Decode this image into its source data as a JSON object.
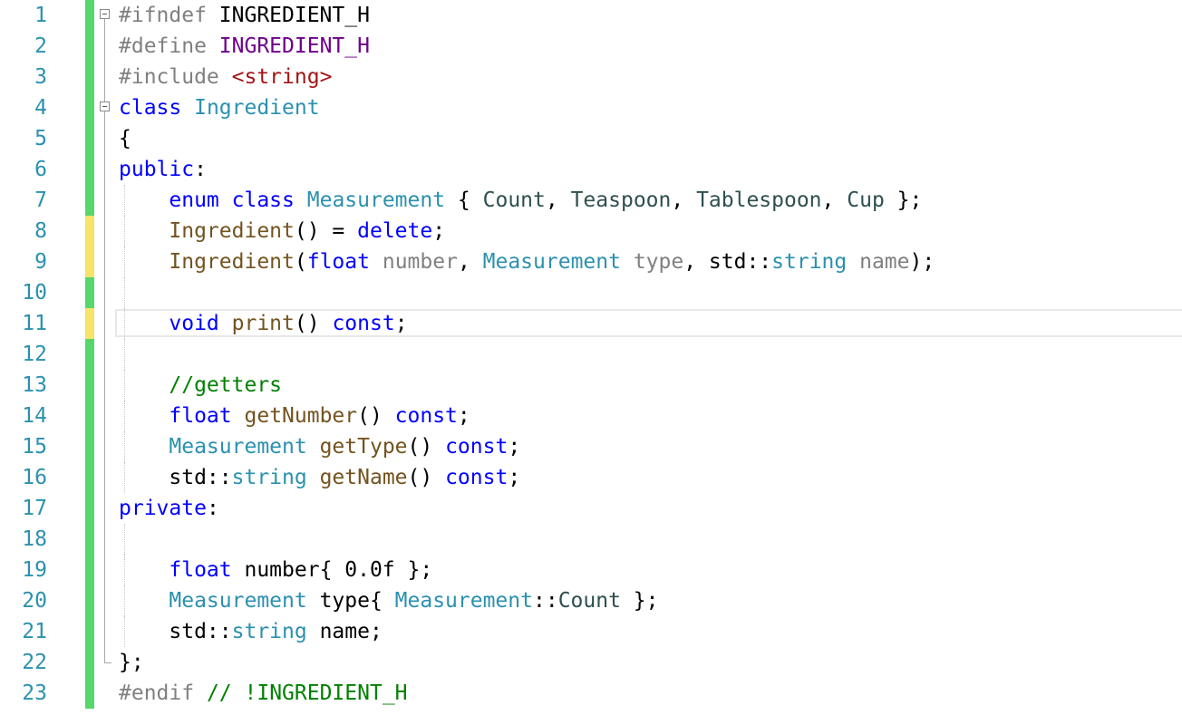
{
  "editor": {
    "lines": [
      {
        "number": "1",
        "change": "saved",
        "fold": "open",
        "segments": [
          {
            "cls": "pp",
            "text": "#ifndef"
          },
          {
            "cls": "plain",
            "text": " INGREDIENT_H"
          }
        ]
      },
      {
        "number": "2",
        "change": "saved",
        "fold": "",
        "segments": [
          {
            "cls": "pp",
            "text": "#define"
          },
          {
            "cls": "plain",
            "text": " "
          },
          {
            "cls": "mac",
            "text": "INGREDIENT_H"
          }
        ]
      },
      {
        "number": "3",
        "change": "saved",
        "fold": "",
        "segments": [
          {
            "cls": "pp",
            "text": "#include"
          },
          {
            "cls": "plain",
            "text": " "
          },
          {
            "cls": "str",
            "text": "<string>"
          }
        ]
      },
      {
        "number": "4",
        "change": "saved",
        "fold": "open",
        "segments": [
          {
            "cls": "kw",
            "text": "class"
          },
          {
            "cls": "plain",
            "text": " "
          },
          {
            "cls": "ty",
            "text": "Ingredient"
          }
        ]
      },
      {
        "number": "5",
        "change": "saved",
        "fold": "",
        "segments": [
          {
            "cls": "plain",
            "text": "{"
          }
        ]
      },
      {
        "number": "6",
        "change": "saved",
        "fold": "",
        "segments": [
          {
            "cls": "kw",
            "text": "public"
          },
          {
            "cls": "plain",
            "text": ":"
          }
        ]
      },
      {
        "number": "7",
        "change": "saved",
        "fold": "",
        "segments": [
          {
            "cls": "plain",
            "text": "    "
          },
          {
            "cls": "kw",
            "text": "enum"
          },
          {
            "cls": "plain",
            "text": " "
          },
          {
            "cls": "kw",
            "text": "class"
          },
          {
            "cls": "plain",
            "text": " "
          },
          {
            "cls": "ty",
            "text": "Measurement"
          },
          {
            "cls": "plain",
            "text": " { "
          },
          {
            "cls": "enumv",
            "text": "Count"
          },
          {
            "cls": "plain",
            "text": ", "
          },
          {
            "cls": "enumv",
            "text": "Teaspoon"
          },
          {
            "cls": "plain",
            "text": ", "
          },
          {
            "cls": "enumv",
            "text": "Tablespoon"
          },
          {
            "cls": "plain",
            "text": ", "
          },
          {
            "cls": "enumv",
            "text": "Cup"
          },
          {
            "cls": "plain",
            "text": " };"
          }
        ]
      },
      {
        "number": "8",
        "change": "modified",
        "fold": "",
        "segments": [
          {
            "cls": "plain",
            "text": "    "
          },
          {
            "cls": "fn",
            "text": "Ingredient"
          },
          {
            "cls": "plain",
            "text": "() = "
          },
          {
            "cls": "kw",
            "text": "delete"
          },
          {
            "cls": "plain",
            "text": ";"
          }
        ]
      },
      {
        "number": "9",
        "change": "modified",
        "fold": "",
        "segments": [
          {
            "cls": "plain",
            "text": "    "
          },
          {
            "cls": "fn",
            "text": "Ingredient"
          },
          {
            "cls": "plain",
            "text": "("
          },
          {
            "cls": "kw",
            "text": "float"
          },
          {
            "cls": "plain",
            "text": " "
          },
          {
            "cls": "param",
            "text": "number"
          },
          {
            "cls": "plain",
            "text": ", "
          },
          {
            "cls": "ty",
            "text": "Measurement"
          },
          {
            "cls": "plain",
            "text": " "
          },
          {
            "cls": "param",
            "text": "type"
          },
          {
            "cls": "plain",
            "text": ", std::"
          },
          {
            "cls": "ty",
            "text": "string"
          },
          {
            "cls": "plain",
            "text": " "
          },
          {
            "cls": "param",
            "text": "name"
          },
          {
            "cls": "plain",
            "text": ");"
          }
        ]
      },
      {
        "number": "10",
        "change": "saved",
        "fold": "",
        "segments": []
      },
      {
        "number": "11",
        "change": "modified",
        "fold": "",
        "current": true,
        "segments": [
          {
            "cls": "plain",
            "text": "    "
          },
          {
            "cls": "kw",
            "text": "void"
          },
          {
            "cls": "plain",
            "text": " "
          },
          {
            "cls": "fn",
            "text": "print"
          },
          {
            "cls": "plain",
            "text": "() "
          },
          {
            "cls": "kw",
            "text": "const"
          },
          {
            "cls": "plain",
            "text": ";"
          }
        ]
      },
      {
        "number": "12",
        "change": "saved",
        "fold": "",
        "segments": []
      },
      {
        "number": "13",
        "change": "saved",
        "fold": "",
        "segments": [
          {
            "cls": "plain",
            "text": "    "
          },
          {
            "cls": "cmt",
            "text": "//getters"
          }
        ]
      },
      {
        "number": "14",
        "change": "saved",
        "fold": "",
        "segments": [
          {
            "cls": "plain",
            "text": "    "
          },
          {
            "cls": "kw",
            "text": "float"
          },
          {
            "cls": "plain",
            "text": " "
          },
          {
            "cls": "fn",
            "text": "getNumber"
          },
          {
            "cls": "plain",
            "text": "() "
          },
          {
            "cls": "kw",
            "text": "const"
          },
          {
            "cls": "plain",
            "text": ";"
          }
        ]
      },
      {
        "number": "15",
        "change": "saved",
        "fold": "",
        "segments": [
          {
            "cls": "plain",
            "text": "    "
          },
          {
            "cls": "ty",
            "text": "Measurement"
          },
          {
            "cls": "plain",
            "text": " "
          },
          {
            "cls": "fn",
            "text": "getType"
          },
          {
            "cls": "plain",
            "text": "() "
          },
          {
            "cls": "kw",
            "text": "const"
          },
          {
            "cls": "plain",
            "text": ";"
          }
        ]
      },
      {
        "number": "16",
        "change": "saved",
        "fold": "",
        "segments": [
          {
            "cls": "plain",
            "text": "    std::"
          },
          {
            "cls": "ty",
            "text": "string"
          },
          {
            "cls": "plain",
            "text": " "
          },
          {
            "cls": "fn",
            "text": "getName"
          },
          {
            "cls": "plain",
            "text": "() "
          },
          {
            "cls": "kw",
            "text": "const"
          },
          {
            "cls": "plain",
            "text": ";"
          }
        ]
      },
      {
        "number": "17",
        "change": "saved",
        "fold": "",
        "segments": [
          {
            "cls": "kw",
            "text": "private"
          },
          {
            "cls": "plain",
            "text": ":"
          }
        ]
      },
      {
        "number": "18",
        "change": "saved",
        "fold": "",
        "segments": []
      },
      {
        "number": "19",
        "change": "saved",
        "fold": "",
        "segments": [
          {
            "cls": "plain",
            "text": "    "
          },
          {
            "cls": "kw",
            "text": "float"
          },
          {
            "cls": "plain",
            "text": " number{ 0.0f };"
          }
        ]
      },
      {
        "number": "20",
        "change": "saved",
        "fold": "",
        "segments": [
          {
            "cls": "plain",
            "text": "    "
          },
          {
            "cls": "ty",
            "text": "Measurement"
          },
          {
            "cls": "plain",
            "text": " type{ "
          },
          {
            "cls": "ty",
            "text": "Measurement"
          },
          {
            "cls": "plain",
            "text": "::"
          },
          {
            "cls": "enumv",
            "text": "Count"
          },
          {
            "cls": "plain",
            "text": " };"
          }
        ]
      },
      {
        "number": "21",
        "change": "saved",
        "fold": "",
        "segments": [
          {
            "cls": "plain",
            "text": "    std::"
          },
          {
            "cls": "ty",
            "text": "string"
          },
          {
            "cls": "plain",
            "text": " name;"
          }
        ]
      },
      {
        "number": "22",
        "change": "saved",
        "fold": "end",
        "segments": [
          {
            "cls": "plain",
            "text": "};"
          }
        ]
      },
      {
        "number": "23",
        "change": "saved",
        "fold": "",
        "segments": [
          {
            "cls": "pp",
            "text": "#endif"
          },
          {
            "cls": "plain",
            "text": " "
          },
          {
            "cls": "cmt",
            "text": "// !INGREDIENT_H"
          }
        ]
      }
    ]
  },
  "colors": {
    "line_number": "#2b91af",
    "saved_change": "#57d66b",
    "modified_change": "#f5e36a",
    "keyword": "#0000ff",
    "type": "#2b91af",
    "macro": "#6f008a",
    "string": "#a31515",
    "function": "#74531f",
    "comment": "#008000",
    "preprocessor": "#808080"
  }
}
